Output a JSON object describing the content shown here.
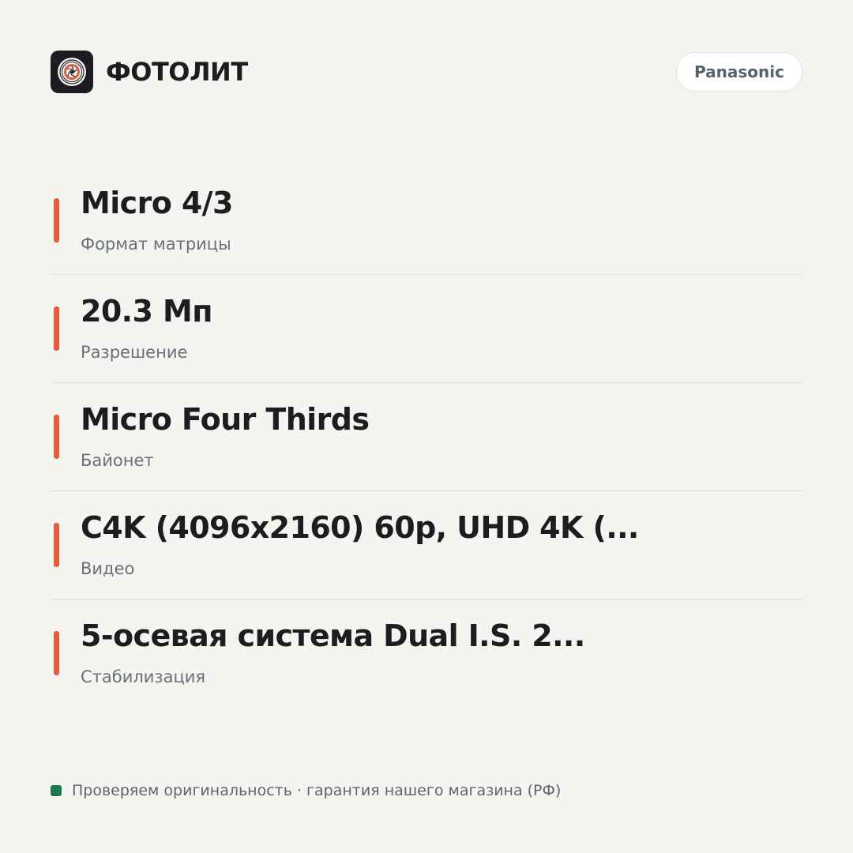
{
  "header": {
    "brand_name": "ФОТОЛИТ",
    "brand_pill": "Panasonic"
  },
  "specs": [
    {
      "value": "Micro 4/3",
      "label": "Формат матрицы"
    },
    {
      "value": "20.3 Мп",
      "label": "Разрешение"
    },
    {
      "value": "Micro Four Thirds",
      "label": "Байонет"
    },
    {
      "value": "C4K (4096x2160) 60p, UHD 4K (...",
      "label": "Видео"
    },
    {
      "value": "5-осевая система Dual I.S. 2...",
      "label": "Стабилизация"
    }
  ],
  "footer": {
    "text": "Проверяем оригинальность · гарантия нашего магазина (РФ)"
  },
  "colors": {
    "accent": "#e15f3a",
    "status": "#1e7a4a",
    "background": "#f5f4f0",
    "logo_bg": "#1c1d21"
  }
}
